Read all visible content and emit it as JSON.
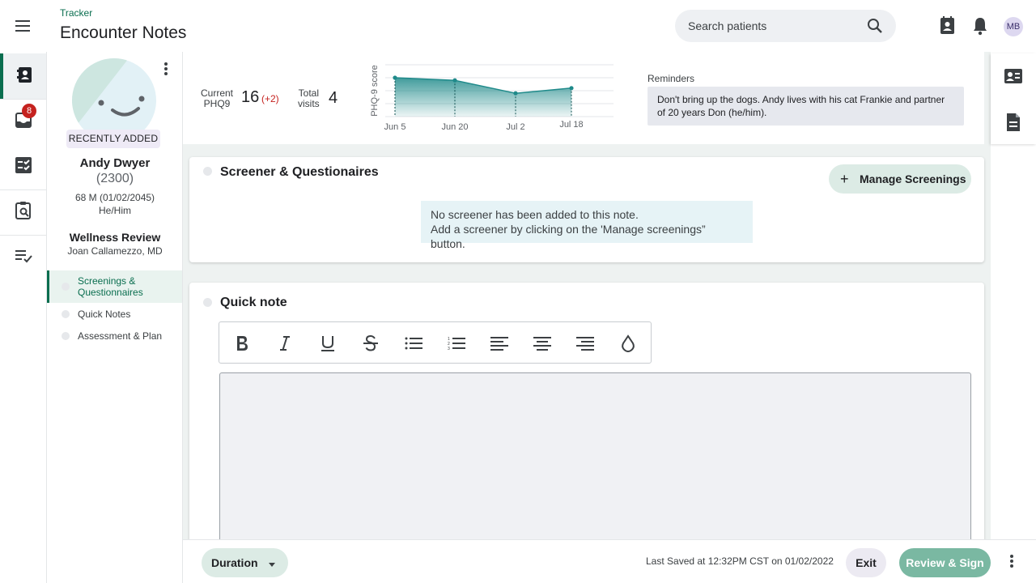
{
  "header": {
    "breadcrumb": "Tracker",
    "title": "Encounter Notes",
    "search_placeholder": "Search patients",
    "avatar_initials": "MB"
  },
  "rail": {
    "notifications_count": "8"
  },
  "patient": {
    "status_badge": "RECENTLY ADDED",
    "name": "Andy Dwyer",
    "id": "(2300)",
    "demographics": "68 M (01/02/2045)",
    "pronouns": "He/Him",
    "visit_type": "Wellness Review",
    "provider": "Joan Callamezzo, MD",
    "sections": [
      {
        "label": "Screenings & Questionnaires",
        "active": true
      },
      {
        "label": "Quick Notes",
        "active": false
      },
      {
        "label": "Assessment & Plan",
        "active": false
      }
    ]
  },
  "summary": {
    "current_label_line1": "Current",
    "current_label_line2": "PHQ9",
    "current_value": "16",
    "current_delta": "(+2)",
    "visits_label_line1": "Total",
    "visits_label_line2": "visits",
    "visits_value": "4",
    "reminders_label": "Reminders",
    "reminder_text": "Don't bring up the dogs. Andy lives with his cat Frankie and partner of 20 years Don (he/him)."
  },
  "chart_data": {
    "type": "area",
    "ylabel": "PHQ-9 score",
    "x": [
      "Jun 5",
      "Jun 20",
      "Jul 2",
      "Jul 18"
    ],
    "values": [
      15,
      14,
      9,
      11
    ],
    "ylim": [
      0,
      20
    ],
    "grid": true,
    "color": "#1f8a8a"
  },
  "screener_card": {
    "title": "Screener & Questionaires",
    "manage_button": "Manage Screenings",
    "empty_line1": "No screener has been added to this note.",
    "empty_line2": "Add a screener by clicking on the 'Manage screenings” button."
  },
  "note_card": {
    "title": "Quick note",
    "toolbar": [
      "bold-icon",
      "italic-icon",
      "underline-icon",
      "strikethrough-icon",
      "bulleted-list-icon",
      "numbered-list-icon",
      "align-left-icon",
      "align-center-icon",
      "align-right-icon",
      "color-drop-icon"
    ]
  },
  "bottom_bar": {
    "duration_label": "Duration",
    "last_saved": "Last Saved at 12:32PM CST on 01/02/2022",
    "exit_label": "Exit",
    "sign_label": "Review & Sign"
  },
  "colors": {
    "brand_green": "#0a6e4f",
    "badge_red": "#c5221f",
    "chart_teal": "#1f8a8a"
  }
}
